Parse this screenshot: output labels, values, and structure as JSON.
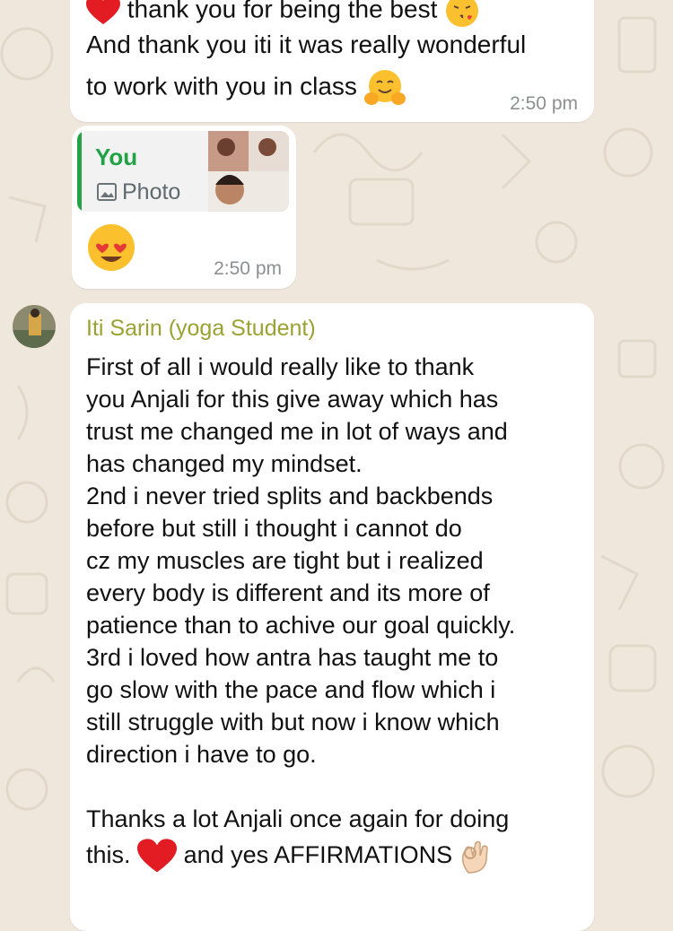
{
  "chat": {
    "colors": {
      "background": "#efe7dc",
      "bubble": "#ffffff",
      "quote_author": "#1fa346",
      "sender_name": "#9aa232",
      "timestamp": "#8b8f91"
    },
    "message_1": {
      "lines": [
        "thank you for being the best",
        "And thank you iti it was really wonderful",
        "to work with you in class"
      ],
      "emojis": [
        "red-heart",
        "face-blowing-kiss",
        "hugging-face"
      ],
      "time": "2:50 pm"
    },
    "message_2": {
      "quoted_author": "You",
      "quoted_type": "Photo",
      "emoji": "smiling-face-with-heart-eyes",
      "time": "2:50 pm"
    },
    "message_3": {
      "sender": "Iti Sarin (yoga Student)",
      "lines": [
        "First of all i would really like to thank",
        "you Anjali for this give away which has",
        "trust me changed me in lot of ways and",
        "has changed my mindset.",
        "2nd i never tried splits and backbends",
        "before but still i thought i cannot do",
        "cz my muscles are tight but i realized",
        "every body is different and its more of",
        "patience than to achive our goal quickly.",
        "3rd i loved how antra has taught me to",
        "go slow with the pace and flow which i",
        "still struggle with but now i know which",
        "direction i have to go.",
        "",
        "Thanks a lot Anjali once again for doing"
      ],
      "last_line_part1": "this.",
      "last_line_part2": "and yes AFFIRMATIONS",
      "emojis": [
        "red-heart",
        "ok-hand"
      ]
    }
  }
}
